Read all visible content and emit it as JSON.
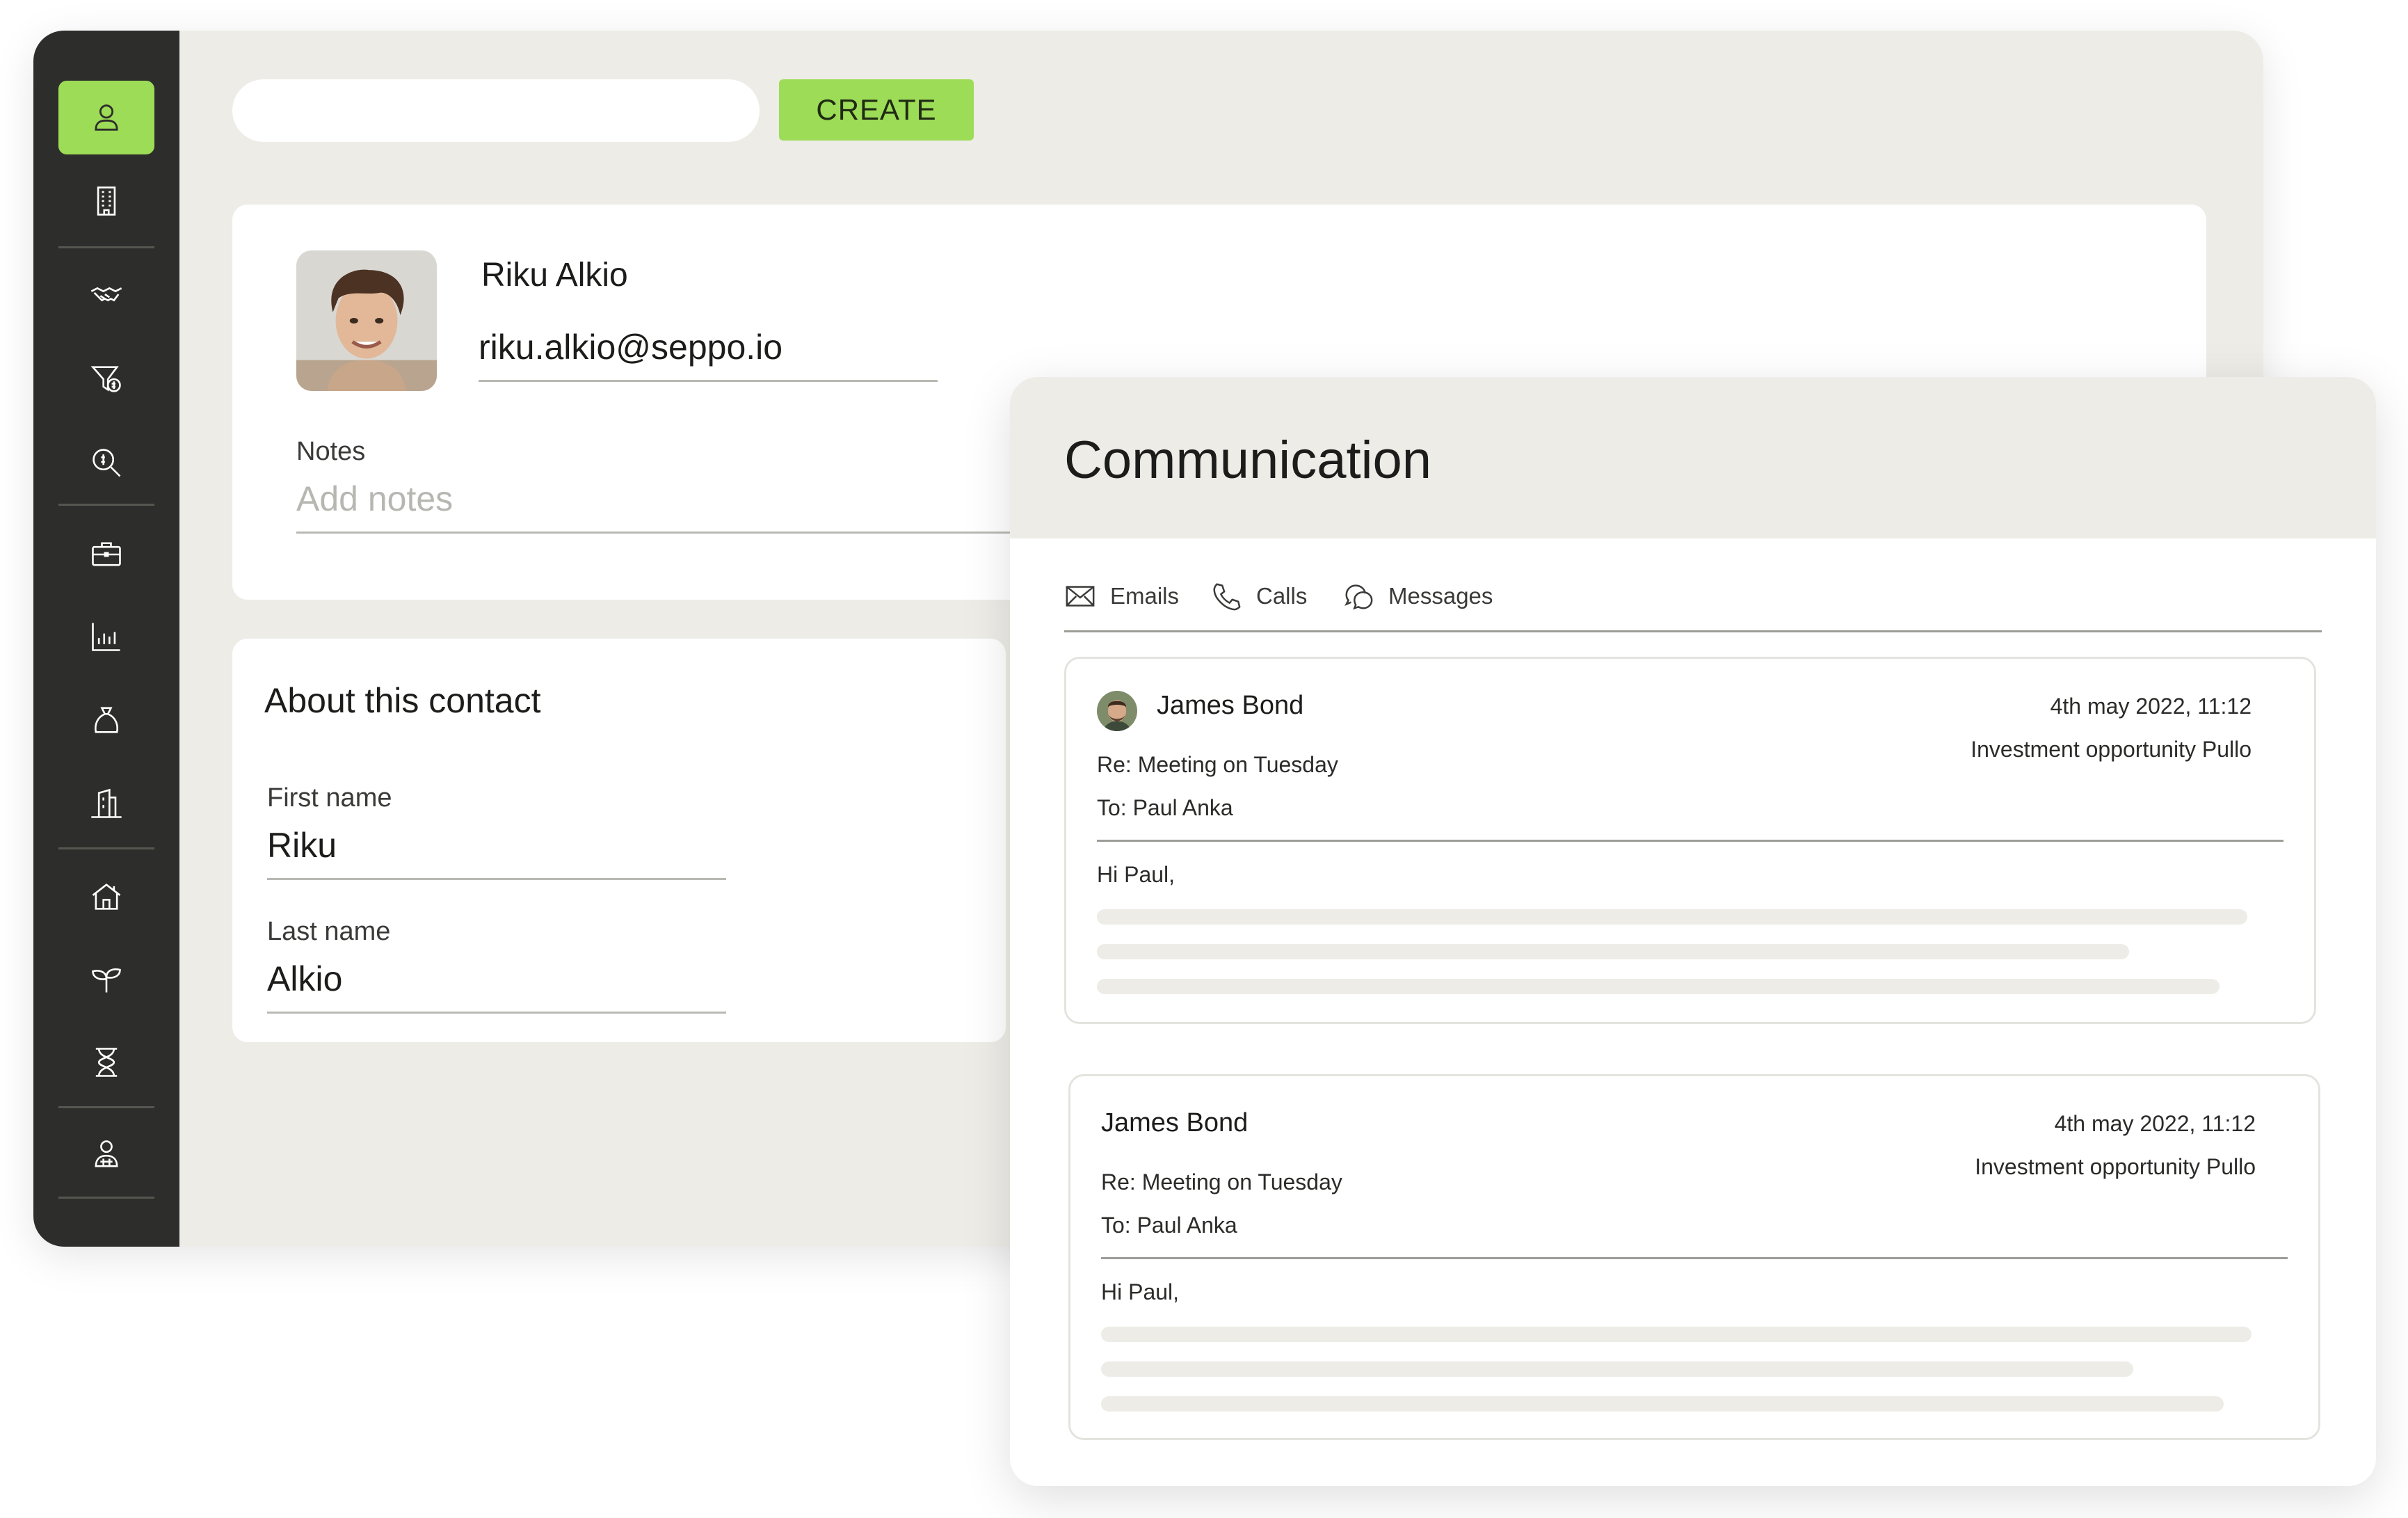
{
  "sidebar": {
    "items": [
      {
        "icon": "user-icon",
        "active": true
      },
      {
        "icon": "building-icon"
      },
      {
        "icon": "handshake-icon"
      },
      {
        "icon": "funnel-dollar-icon"
      },
      {
        "icon": "search-dollar-icon"
      },
      {
        "icon": "briefcase-icon"
      },
      {
        "icon": "bar-chart-icon"
      },
      {
        "icon": "money-bag-icon"
      },
      {
        "icon": "office-building-icon"
      },
      {
        "icon": "house-icon"
      },
      {
        "icon": "sprout-icon"
      },
      {
        "icon": "hourglass-icon"
      },
      {
        "icon": "team-icon"
      }
    ]
  },
  "toolbar": {
    "search_placeholder": "",
    "create_label": "CREATE"
  },
  "contact": {
    "name": "Riku Alkio",
    "email": "riku.alkio@seppo.io",
    "notes_label": "Notes",
    "notes_placeholder": "Add notes"
  },
  "about": {
    "title": "About this contact",
    "first_name_label": "First name",
    "first_name": "Riku",
    "last_name_label": "Last name",
    "last_name": "Alkio"
  },
  "communication": {
    "title": "Communication",
    "tabs": [
      "Emails",
      "Calls",
      "Messages"
    ],
    "messages": [
      {
        "sender": "James Bond",
        "date": "4th may 2022, 11:12",
        "opportunity": "Investment opportunity Pullo",
        "subject": "Re: Meeting on Tuesday",
        "to": "To: Paul Anka",
        "greeting": "Hi Paul,",
        "has_avatar": true
      },
      {
        "sender": "James Bond",
        "date": "4th may 2022, 11:12",
        "opportunity": "Investment opportunity Pullo",
        "subject": "Re: Meeting on Tuesday",
        "to": "To: Paul Anka",
        "greeting": "Hi Paul,",
        "has_avatar": false
      }
    ]
  },
  "colors": {
    "accent_green": "#9ddc56",
    "sidebar_bg": "#2d2e2b",
    "window_bg": "#edece7"
  }
}
